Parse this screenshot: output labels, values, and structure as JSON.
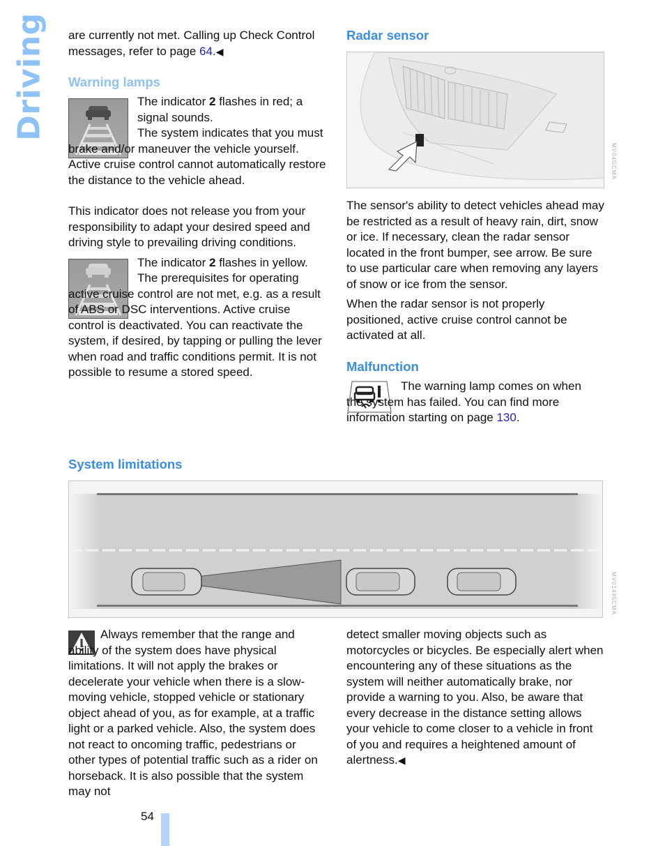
{
  "side_tab": {
    "label": "Driving"
  },
  "left_column": {
    "intro": {
      "text_before_link": "are currently not met. Calling up Check Control messages, refer to page ",
      "link": "64",
      "text_after_link": ".",
      "end_marker": "◀"
    },
    "warning_lamps": {
      "heading": "Warning lamps",
      "red": {
        "icon": "acc-distance-indicator-red",
        "line1_pre": "The indicator ",
        "line1_bold": "2",
        "line1_post": " flashes in red; a signal sounds.",
        "line2": "The system indicates that you must brake and/or maneuver the vehicle yourself. Active cruise control cannot automatically restore the distance to the vehicle ahead.",
        "line3": "This indicator does not release you from your responsibility to adapt your desired speed and driving style to prevailing driving conditions."
      },
      "yellow": {
        "icon": "acc-distance-indicator-yellow",
        "line1_pre": "The indicator ",
        "line1_bold": "2",
        "line1_post": " flashes in yellow.",
        "line2": "The prerequisites for operating active cruise control are not met, e.g. as a result of ABS or DSC interventions. Active cruise control is deactivated. You can reactivate the system, if desired, by tapping or pulling the lever when road and traffic conditions permit. It is not possible to resume a stored speed."
      }
    }
  },
  "right_column": {
    "radar_sensor": {
      "heading": "Radar sensor",
      "image_code": "MV04GCMA",
      "paragraph1": "The sensor's ability to detect vehicles ahead may be restricted as a result of heavy rain, dirt, snow or ice. If necessary, clean the radar sensor located in the front bumper, see arrow. Be sure to use particular care when removing any layers of snow or ice from the sensor.",
      "paragraph2": "When the radar sensor is not properly positioned, active cruise control cannot be activated at all."
    },
    "malfunction": {
      "heading": "Malfunction",
      "icon": "acc-malfunction-warning-lamp",
      "text_before_link": "The warning lamp comes on when the system has failed. You can find more information starting on page ",
      "link": "130",
      "text_after_link": "."
    }
  },
  "system_limitations": {
    "heading": "System limitations",
    "image_code": "MV01495CMA",
    "warning_col1": "Always remember that the range and ability of the system does have physical limitations. It will not apply the brakes or decelerate your vehicle when there is a slow-moving vehicle, stopped vehicle or stationary object ahead of you, as for example, at a traffic light or a parked vehicle. Also, the system does not react to oncoming traffic, pedestrians or other types of potential traffic such as a rider on horseback. It is also possible that the system may not",
    "warning_col2": "detect smaller moving objects such as motorcycles or bicycles. Be especially alert when encountering any of these situations as the system will neither automatically brake, nor provide a warning to you. Also, be aware that every decrease in the distance setting allows your vehicle to come closer to a vehicle in front of you and requires a heightened amount of alertness.",
    "end_marker": "◀"
  },
  "footer": {
    "page_number": "54"
  },
  "colors": {
    "heading": "#3a8de3",
    "heading_light": "#8ec1f5",
    "link": "#1f1fd6",
    "tab_bar": "#b3d4fb"
  }
}
